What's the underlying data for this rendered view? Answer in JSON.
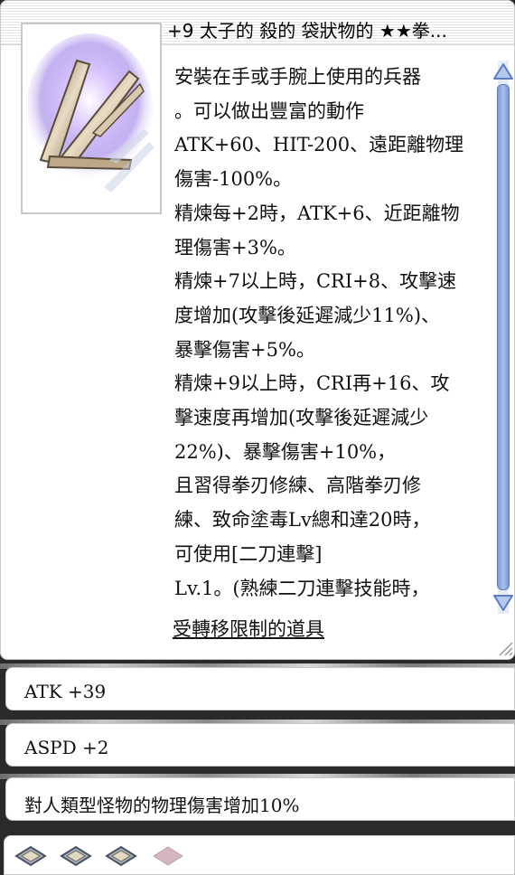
{
  "window": {
    "title": "+9 太子的 殺的 袋狀物的 ★★拳..."
  },
  "item": {
    "image_icon": "katar-weapon-icon",
    "description_lines": [
      "安裝在手或手腕上使用的兵器",
      "。可以做出豐富的動作",
      "ATK+60、HIT-200、遠距離物理",
      "傷害-100%。",
      "精煉每+2時，ATK+6、近距離物",
      "理傷害+3%。",
      "精煉+7以上時，CRI+8、攻擊速",
      "度增加(攻擊後延遲減少11%)、",
      "暴擊傷害+5%。",
      "精煉+9以上時，CRI再+16、攻",
      "擊速度再增加(攻擊後延遲減少",
      "22%)、暴擊傷害+10%，",
      "且習得拳刃修練、高階拳刃修",
      "練、致命塗毒Lv總和達20時，",
      "可使用[二刀連擊]",
      "Lv.1。(熟練二刀連擊技能時，"
    ],
    "trade_limit_link": "受轉移限制的道具"
  },
  "options": [
    {
      "label": "ATK +39"
    },
    {
      "label": "ASPD +2"
    },
    {
      "label": "對人類型怪物的物理傷害增加10%"
    }
  ],
  "card_slots": [
    {
      "icon": "card-slot-filled-icon",
      "state": "filled"
    },
    {
      "icon": "card-slot-filled-icon",
      "state": "filled"
    },
    {
      "icon": "card-slot-filled-icon",
      "state": "filled"
    },
    {
      "icon": "card-slot-empty-icon",
      "state": "empty"
    }
  ],
  "colors": {
    "scroll_thumb": "#8aa6e0",
    "slot_filled": "#9aa3b0",
    "slot_empty": "#c9a9b6"
  }
}
